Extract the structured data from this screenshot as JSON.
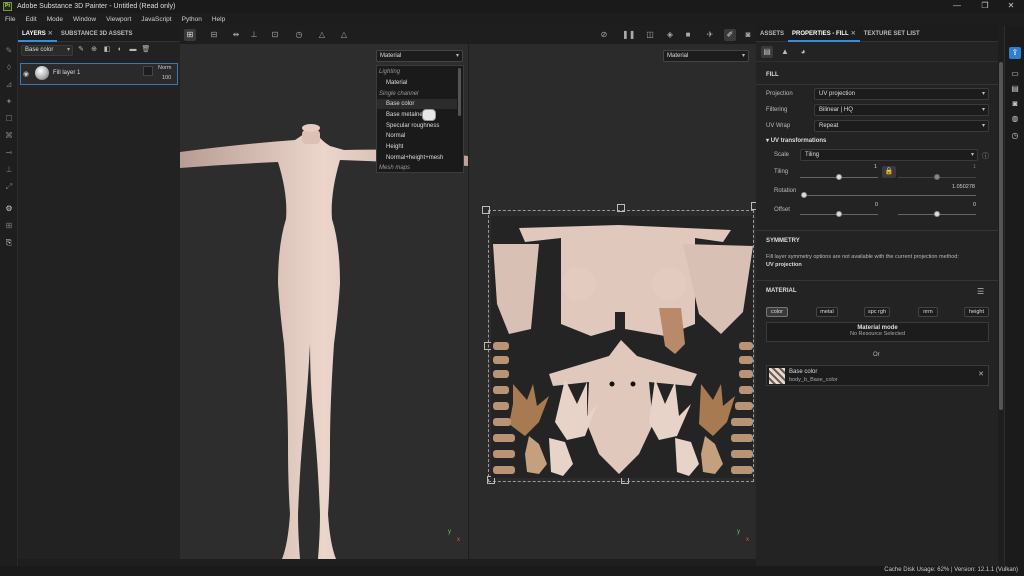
{
  "window": {
    "title": "Adobe Substance 3D Painter - Untitled (Read only)",
    "app_icon": "Pt",
    "minimize": "—",
    "maximize": "❐",
    "close": "✕"
  },
  "menu": [
    "File",
    "Edit",
    "Mode",
    "Window",
    "Viewport",
    "JavaScript",
    "Python",
    "Help"
  ],
  "layers_panel": {
    "tabs": [
      {
        "label": "LAYERS",
        "close": "✕"
      },
      {
        "label": "SUBSTANCE 3D ASSETS"
      }
    ],
    "channel_select": "Base color",
    "layer": {
      "name": "Fill layer 1",
      "blend": "Norm",
      "opacity": "100"
    }
  },
  "viewport_3d": {
    "channel_select": "Material",
    "axis_y": "y",
    "axis_x": "x"
  },
  "viewport_2d": {
    "channel_select": "Material",
    "axis_y": "y",
    "axis_x": "x"
  },
  "dropdown": {
    "items": [
      {
        "label": "Lighting",
        "category": true
      },
      {
        "label": "Material",
        "category": false
      },
      {
        "label": "Single channel",
        "category": true
      },
      {
        "label": "Base color",
        "category": false,
        "highlighted": true
      },
      {
        "label": "Base metalness",
        "category": false
      },
      {
        "label": "Specular roughness",
        "category": false
      },
      {
        "label": "Normal",
        "category": false
      },
      {
        "label": "Height",
        "category": false
      },
      {
        "label": "Normal+height+mesh",
        "category": false
      },
      {
        "label": "Mesh maps",
        "category": true
      }
    ]
  },
  "right_panel": {
    "tabs": [
      {
        "label": "ASSETS"
      },
      {
        "label": "PROPERTIES - FILL",
        "close": "✕"
      },
      {
        "label": "TEXTURE SET LIST"
      }
    ],
    "fill_title": "FILL",
    "projection_label": "Projection",
    "projection_value": "UV projection",
    "filtering_label": "Filtering",
    "filtering_value": "Bilinear | HQ",
    "uvwrap_label": "UV Wrap",
    "uvwrap_value": "Repeat",
    "uvtrans_title": "UV transformations",
    "scale_label": "Scale",
    "scale_value": "Tiling",
    "tiling_label": "Tiling",
    "tiling_val1": "1",
    "tiling_val2": "1",
    "tiling_level": 0.5,
    "rotation_label": "Rotation",
    "rotation_value": "1.050278",
    "rotation_level": 0.0,
    "offset_label": "Offset",
    "offset_val1": "0",
    "offset_val2": "0",
    "offset_level": 0.5,
    "symmetry_title": "SYMMETRY",
    "symmetry_text": "Fill layer symmetry options are not available with the current projection method:",
    "symmetry_method": "UV projection",
    "material_title": "MATERIAL",
    "chips": [
      "color",
      "metal",
      "spc rgh",
      "nrm",
      "height"
    ],
    "material_mode_title": "Material mode",
    "material_mode_sub": "No Resource Selected",
    "or_label": "Or",
    "base_color_title": "Base color",
    "base_color_file": "body_b_Base_color"
  },
  "status": {
    "text": "Cache Disk Usage:   62% | Version: 12.1.1 (Vulkan)"
  },
  "colors": {
    "accent": "#3d8bd6",
    "active_icon": "#2f7fd1",
    "skin": "#e8cfc4"
  }
}
